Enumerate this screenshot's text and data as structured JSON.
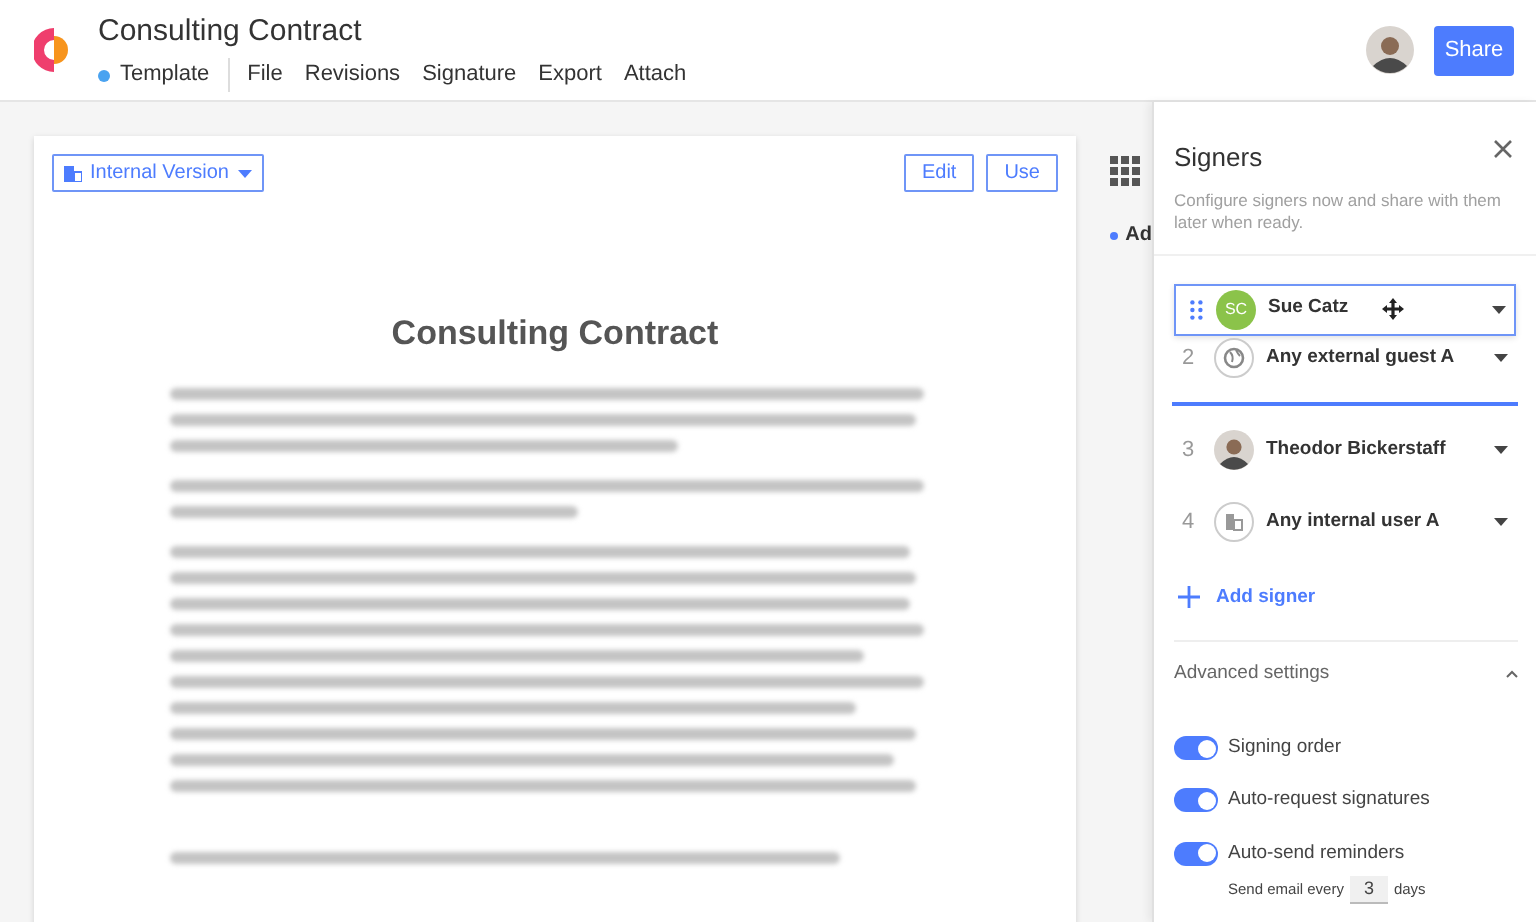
{
  "app": {
    "title": "Consulting Contract",
    "status": "Template",
    "menu": [
      "File",
      "Revisions",
      "Signature",
      "Export",
      "Attach"
    ],
    "share_button": "Share"
  },
  "document": {
    "version_button": "Internal Version",
    "actions": [
      "Edit",
      "Use"
    ],
    "title": "Consulting Contract"
  },
  "side_strip": {
    "label": "Ad"
  },
  "signers_panel": {
    "title": "Signers",
    "description": "Configure signers now and share with them later when ready.",
    "signers": [
      {
        "kind": "initials",
        "initials": "SC",
        "name": "Sue Catz",
        "dragging": true,
        "drop_target": false
      },
      {
        "number": "2",
        "kind": "globe",
        "name": "Any external guest A",
        "dragging": false,
        "drop_target": true
      },
      {
        "number": "3",
        "kind": "photo",
        "name": "Theodor Bickerstaff",
        "dragging": false,
        "drop_target": false
      },
      {
        "number": "4",
        "kind": "building",
        "name": "Any internal user A",
        "dragging": false,
        "drop_target": false
      }
    ],
    "add_signer": "Add signer",
    "advanced": {
      "label": "Advanced settings",
      "expanded": true,
      "toggles": [
        {
          "label": "Signing order",
          "on": true
        },
        {
          "label": "Auto-request signatures",
          "on": true
        },
        {
          "label": "Auto-send reminders",
          "on": true
        }
      ],
      "reminder": {
        "prefix": "Send email every",
        "value": "3",
        "suffix": "days"
      }
    }
  }
}
